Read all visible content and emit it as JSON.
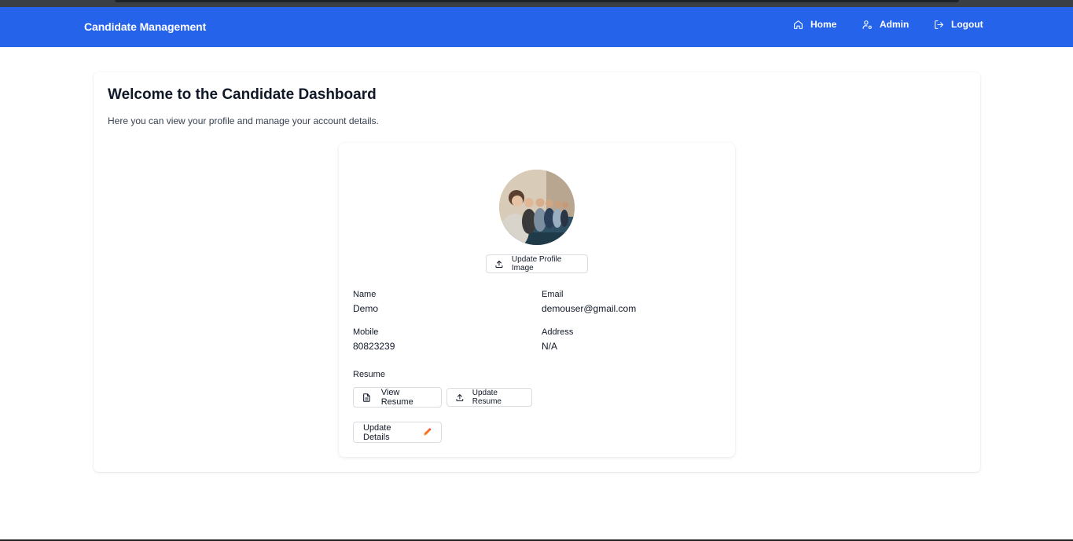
{
  "navbar": {
    "brand": "Candidate Management",
    "items": [
      {
        "label": "Home",
        "icon": "home-icon"
      },
      {
        "label": "Admin",
        "icon": "user-cog-icon"
      },
      {
        "label": "Logout",
        "icon": "logout-icon"
      }
    ]
  },
  "colors": {
    "navbar_bg": "#2563eb",
    "pencil_accent": "#f97316"
  },
  "dashboard": {
    "title": "Welcome to the Candidate Dashboard",
    "subtitle": "Here you can view your profile and manage your account details."
  },
  "profile": {
    "update_image_label": "Update Profile Image",
    "fields": {
      "name_label": "Name",
      "name_value": "Demo",
      "email_label": "Email",
      "email_value": "demouser@gmail.com",
      "mobile_label": "Mobile",
      "mobile_value": "80823239",
      "address_label": "Address",
      "address_value": "N/A"
    },
    "resume_label": "Resume",
    "view_resume_label": "View Resume",
    "update_resume_label": "Update Resume",
    "update_details_label": "Update Details"
  }
}
